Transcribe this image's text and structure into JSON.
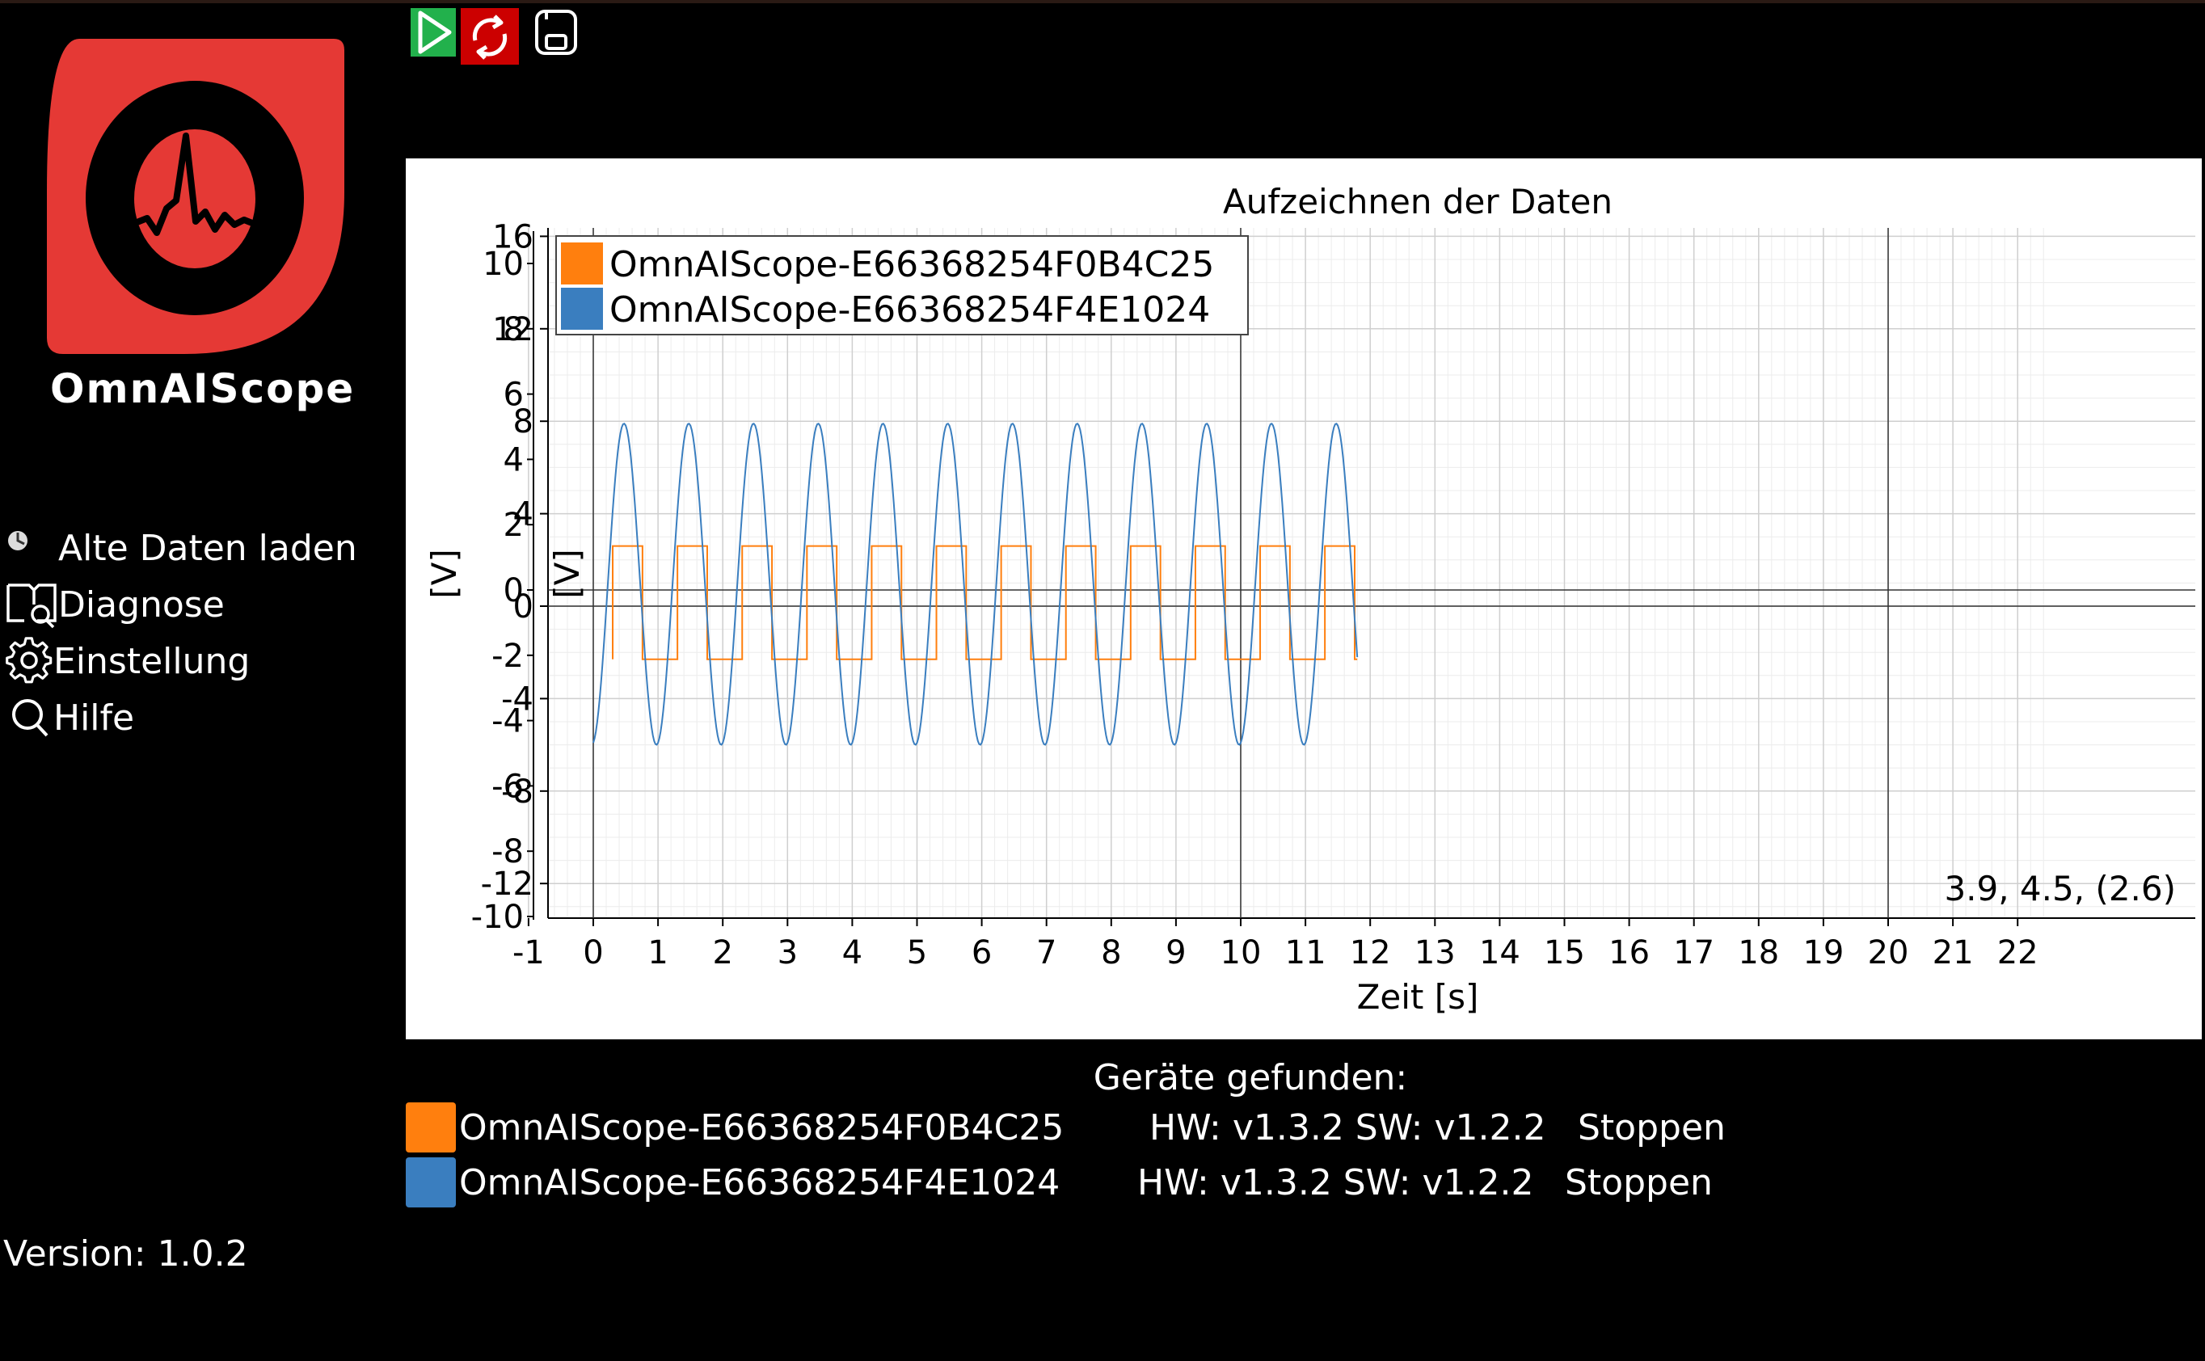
{
  "app": {
    "name": "OmnAIScope",
    "version_label": "Version: 1.0.2"
  },
  "icons": {
    "logo": "omnaiscope-logo-icon",
    "play": "play-icon",
    "refresh": "refresh-icon",
    "save": "save-icon",
    "load": "load-data-icon",
    "diagnose": "diagnose-icon",
    "settings": "gear-icon",
    "help": "search-icon"
  },
  "colors": {
    "accent": "#e53935",
    "play_green": "#22b14c",
    "series_orange": "#ff7f0e",
    "series_blue": "#3a7ebf"
  },
  "toolbar": {
    "play": "Start",
    "refresh": "Aktualisieren",
    "save": "Speichern"
  },
  "sidebar": {
    "items": [
      {
        "label": "Alte Daten laden",
        "icon": "load-data-icon"
      },
      {
        "label": "Diagnose",
        "icon": "diagnose-icon"
      },
      {
        "label": "Einstellung",
        "icon": "gear-icon"
      },
      {
        "label": "Hilfe",
        "icon": "search-icon"
      }
    ]
  },
  "chart_data": {
    "type": "line",
    "title": "Aufzeichnen der Daten",
    "xlabel": "Zeit [s]",
    "ylabel_outer": "[V]",
    "ylabel_inner": "[V]",
    "xlim": [
      -1.2,
      22.4
    ],
    "xticks": [
      -1,
      0,
      1,
      2,
      3,
      4,
      5,
      6,
      7,
      8,
      9,
      10,
      11,
      12,
      13,
      14,
      15,
      16,
      17,
      18,
      19,
      20,
      21,
      22
    ],
    "ylim_outer": [
      -10,
      11
    ],
    "yticks_outer": [
      10,
      8,
      6,
      4,
      2,
      0,
      -2,
      -4,
      -6,
      -8,
      -10
    ],
    "ylim_inner": [
      -13,
      16.5
    ],
    "yticks_inner": [
      16,
      12,
      8,
      4,
      0,
      -4,
      -8,
      -12
    ],
    "grid": true,
    "legend_position": "top-left",
    "readout": "3.9, 4.5, (2.6)",
    "series": [
      {
        "name": "OmnAIScope-E66368254F0B4C25",
        "color": "#ff7f0e",
        "shape": "square",
        "x_start": 0.3,
        "x_end": 11.8,
        "period": 1.0,
        "high": 2.6,
        "low": -2.3
      },
      {
        "name": "OmnAIScope-E66368254F4E1024",
        "color": "#3a7ebf",
        "shape": "sine",
        "x_start": 0.0,
        "x_end": 11.8,
        "period": 1.0,
        "max": 7.9,
        "min": -6.0
      }
    ]
  },
  "devices": {
    "title": "Geräte gefunden:",
    "rows": [
      {
        "name": "OmnAIScope-E66368254F0B4C25",
        "version": "HW: v1.3.2 SW: v1.2.2",
        "action": "Stoppen",
        "color": "#ff7f0e"
      },
      {
        "name": "OmnAIScope-E66368254F4E1024",
        "version": "HW: v1.3.2 SW: v1.2.2",
        "action": "Stoppen",
        "color": "#3a7ebf"
      }
    ]
  }
}
